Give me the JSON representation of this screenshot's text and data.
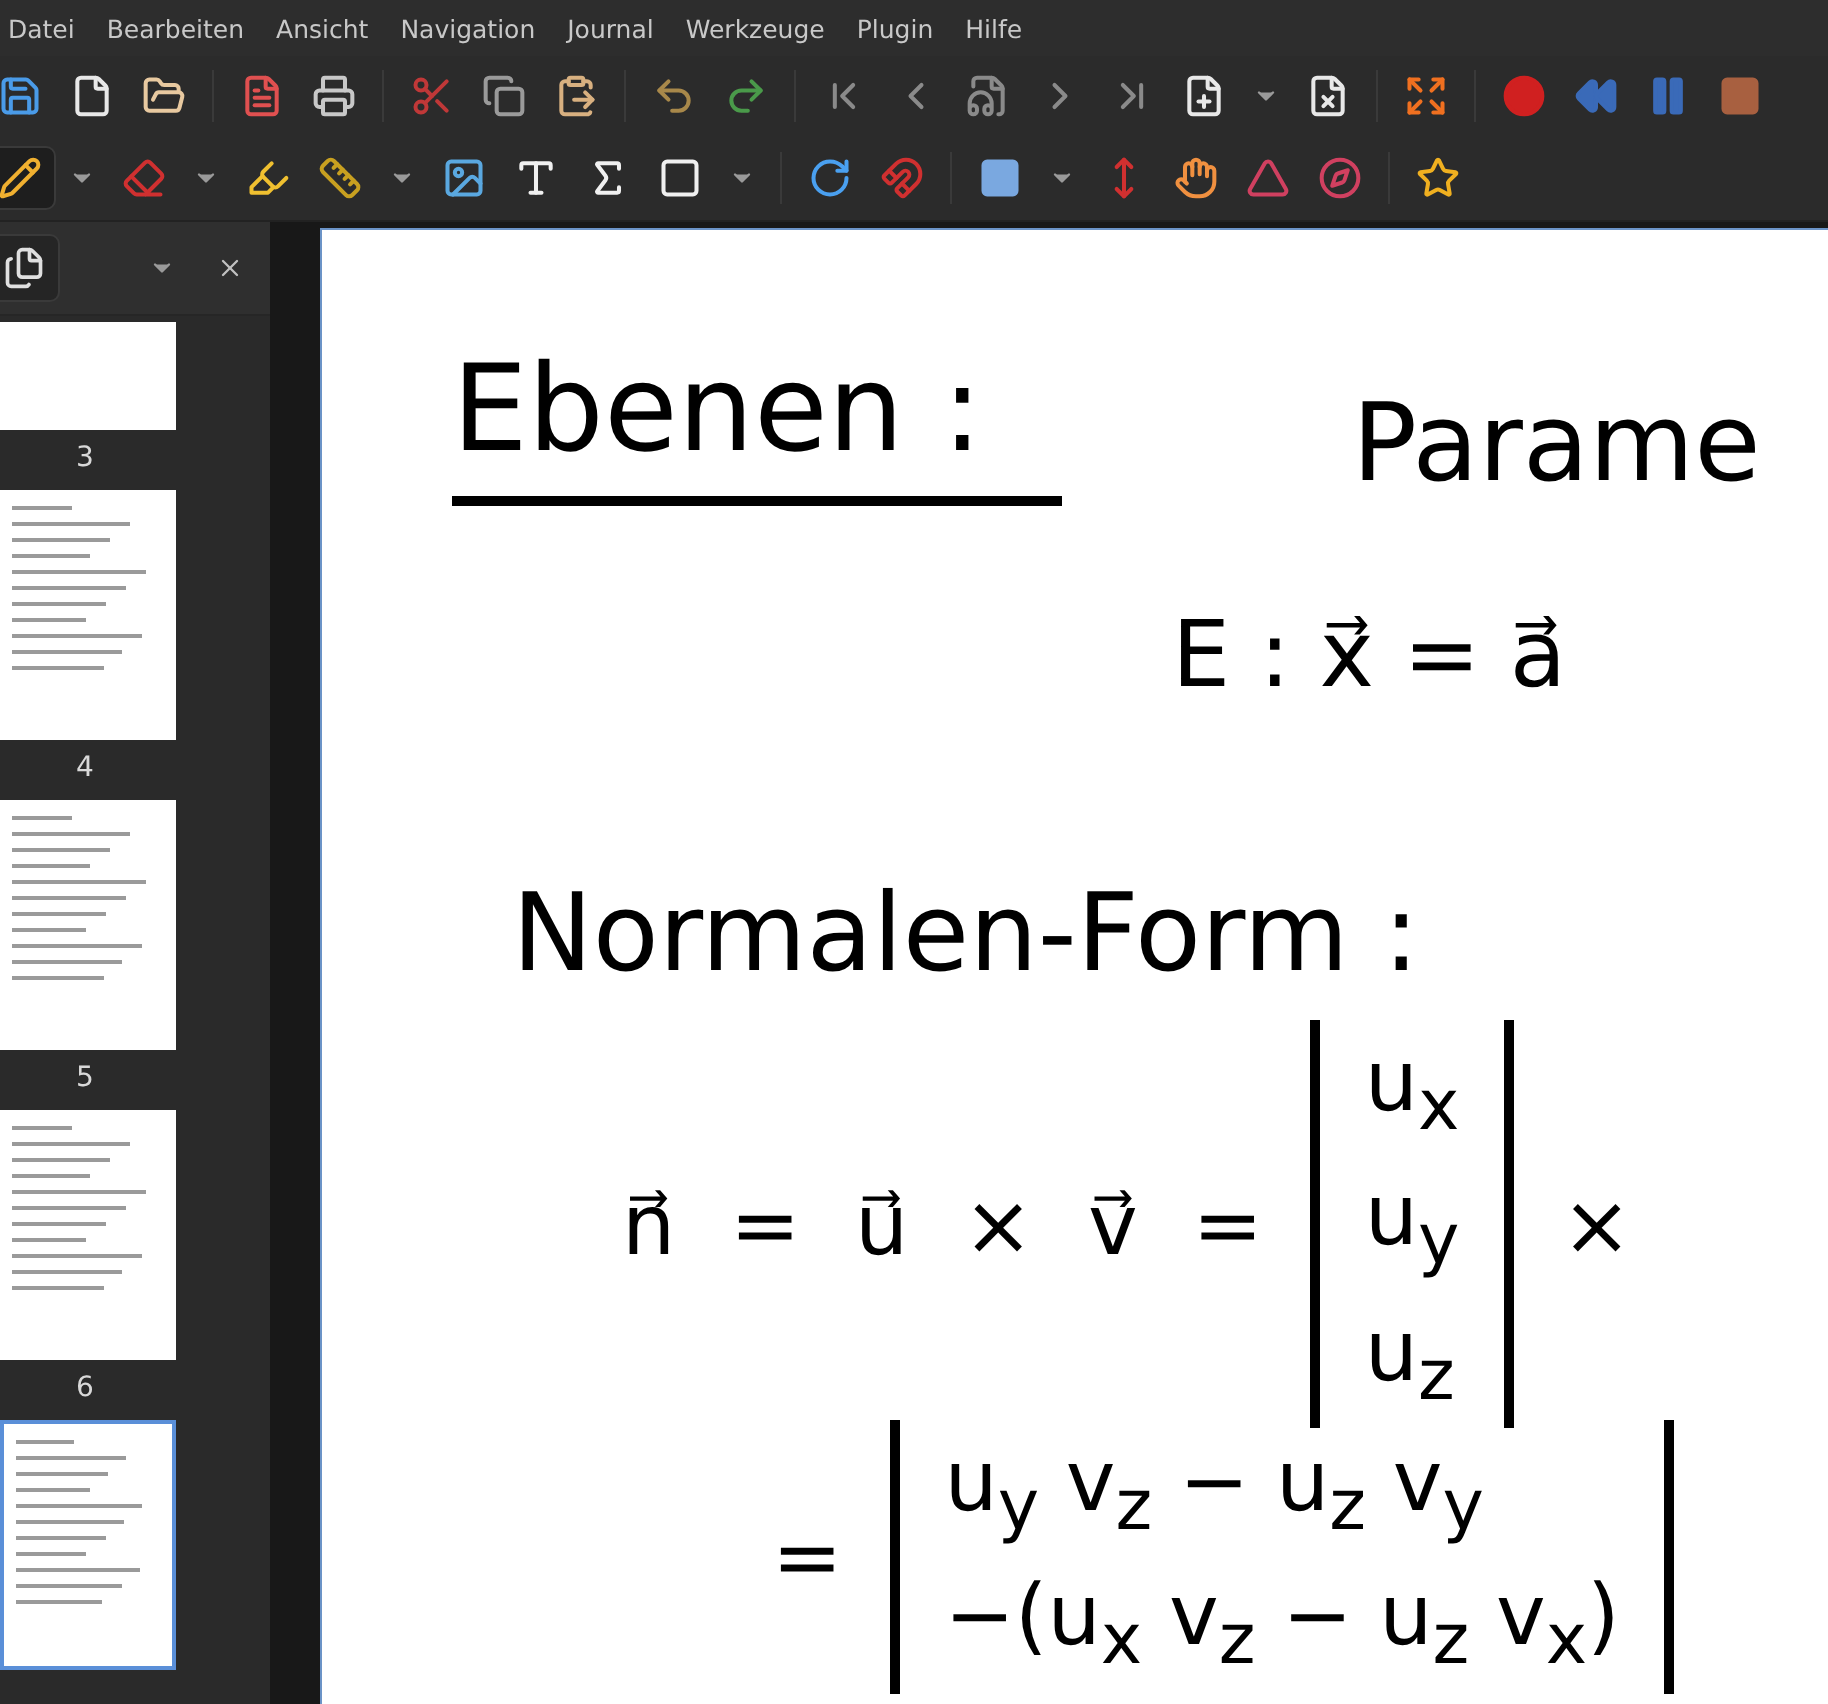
{
  "menu": [
    "Datei",
    "Bearbeiten",
    "Ansicht",
    "Navigation",
    "Journal",
    "Werkzeuge",
    "Plugin",
    "Hilfe"
  ],
  "sidebar": {
    "pages": [
      {
        "number": "3",
        "selected": false
      },
      {
        "number": "4",
        "selected": false
      },
      {
        "number": "5",
        "selected": false
      },
      {
        "number": "6",
        "selected": false
      },
      {
        "selected": true
      }
    ]
  },
  "notes": [
    {
      "kind": "heading",
      "text": "Ebenen :"
    },
    {
      "kind": "text",
      "text": "Parame"
    },
    {
      "kind": "text",
      "text": "E : x⃗ = a⃗"
    },
    {
      "kind": "text",
      "text": "Normalen-Form :"
    },
    {
      "kind": "matrix",
      "left": "n⃗ = u⃗ × v⃗ =",
      "rows": [
        "u$_{x}$",
        "u$_{y}$",
        "u$_{z}$"
      ],
      "right": "×"
    },
    {
      "kind": "matrix",
      "left": "=",
      "rows": [
        "u$_{y}$ v$_{z}$ − u$_{z}$ v$_{y}$",
        "−(u$_{x}$ v$_{z}$ − u$_{z}$ v$_{x}$)"
      ]
    }
  ]
}
